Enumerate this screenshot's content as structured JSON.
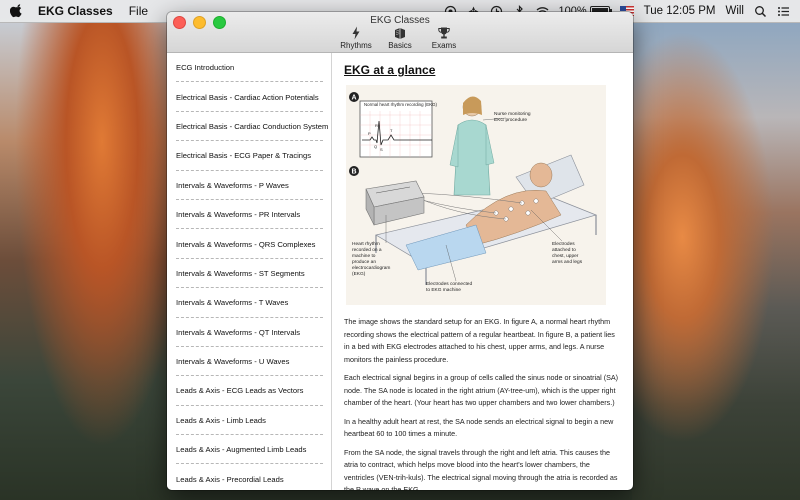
{
  "menubar": {
    "app_name": "EKG Classes",
    "file_menu": "File",
    "battery_text": "100%",
    "battery_level": 1.0,
    "clock": "Tue 12:05 PM",
    "user": "Will"
  },
  "window": {
    "title": "EKG Classes",
    "toolbar": [
      {
        "label": "Rhythms",
        "icon": "lightning-icon"
      },
      {
        "label": "Basics",
        "icon": "book-icon"
      },
      {
        "label": "Exams",
        "icon": "trophy-icon"
      }
    ]
  },
  "sidebar": {
    "items": [
      "ECG Introduction",
      "Electrical Basis - Cardiac Action Potentials",
      "Electrical Basis - Cardiac Conduction System",
      "Electrical Basis - ECG Paper & Tracings",
      "Intervals & Waveforms - P Waves",
      "Intervals & Waveforms - PR Intervals",
      "Intervals & Waveforms - QRS Complexes",
      "Intervals & Waveforms - ST Segments",
      "Intervals & Waveforms - T Waves",
      "Intervals & Waveforms - QT Intervals",
      "Intervals & Waveforms - U Waves",
      "Leads & Axis - ECG Leads as Vectors",
      "Leads & Axis - Limb Leads",
      "Leads & Axis - Augmented Limb Leads",
      "Leads & Axis - Precordial Leads"
    ]
  },
  "content": {
    "heading": "EKG at a glance",
    "figure": {
      "label_a": "A",
      "label_b": "B",
      "normal_rhythm": "Normal heart rhythm recording (EKG)",
      "ecg_letters": {
        "p": "P",
        "q": "Q",
        "r": "R",
        "s": "S",
        "t": "T"
      },
      "nurse": "Nurse monitoring EKG procedure",
      "heart_rhythm": "Heart rhythm recorded on a machine to produce an electrocardiogram (EKG)",
      "electrodes_attached": "Electrodes attached to chest, upper arms and legs",
      "electrodes_connected": "Electrodes connected to EKG machine"
    },
    "paragraphs": [
      "The image shows the standard setup for an EKG. In figure A, a normal heart rhythm recording shows the electrical pattern of a regular heartbeat. In figure B, a patient lies in a bed with EKG electrodes attached to his chest, upper arms, and legs. A nurse monitors the painless procedure.",
      "Each electrical signal begins in a group of cells called the sinus node or sinoatrial (SA) node. The SA node is located in the right atrium (AY-tree-um), which is the upper right chamber of the heart. (Your heart has two upper chambers and two lower chambers.)",
      "In a healthy adult heart at rest, the SA node sends an electrical signal to begin a new heartbeat 60 to 100 times a minute.",
      "From the SA node, the signal travels through the right and left atria. This causes the atria to contract, which helps move blood into the heart's lower chambers, the ventricles (VEN-trih-kuls). The electrical signal moving through the atria is recorded as the P wave on the EKG."
    ]
  }
}
